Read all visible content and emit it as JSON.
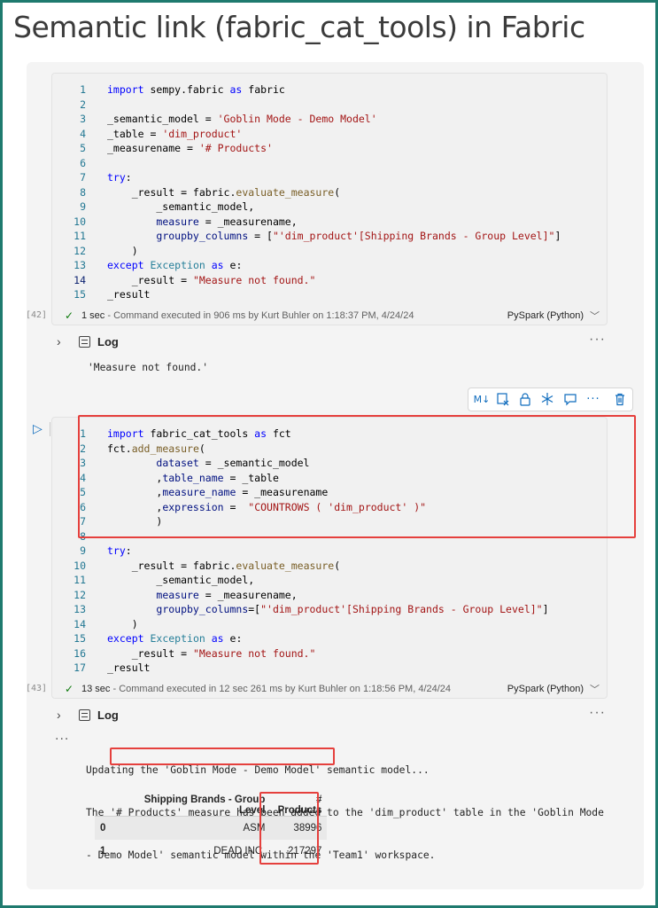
{
  "page_title": "Semantic link (fabric_cat_tools) in Fabric",
  "cell1": {
    "exec_count": "[42]",
    "lines": [
      {
        "n": "1",
        "html": "<span class=\"kw\">import</span> sempy.fabric <span class=\"kw\">as</span> fabric"
      },
      {
        "n": "2",
        "html": ""
      },
      {
        "n": "3",
        "html": "_semantic_model = <span class=\"st\">'Goblin Mode - Demo Model'</span>"
      },
      {
        "n": "4",
        "html": "_table = <span class=\"st\">'dim_product'</span>"
      },
      {
        "n": "5",
        "html": "_measurename = <span class=\"st\">'# Products'</span>"
      },
      {
        "n": "6",
        "html": ""
      },
      {
        "n": "7",
        "html": "<span class=\"kw\">try</span>:"
      },
      {
        "n": "8",
        "html": "    _result = fabric.<span class=\"fn\">evaluate_measure</span>("
      },
      {
        "n": "9",
        "html": "        _semantic_model,"
      },
      {
        "n": "10",
        "html": "        <span class=\"pr\">measure</span> = _measurename,"
      },
      {
        "n": "11",
        "html": "        <span class=\"pr\">groupby_columns</span> = [<span class=\"st\">\"'dim_product'[Shipping Brands - Group Level]\"</span>]"
      },
      {
        "n": "12",
        "html": "    )"
      },
      {
        "n": "13",
        "html": "<span class=\"kw\">except</span> <span class=\"cls\">Exception</span> <span class=\"kw\">as</span> e:"
      },
      {
        "n": "14",
        "html": "    _result = <span class=\"st\">\"Measure not found.\"</span>"
      },
      {
        "n": "15",
        "html": "_result"
      }
    ],
    "status_duration": "1 sec",
    "status_message": "Command executed in 906 ms by Kurt Buhler on 1:18:37 PM, 4/24/24",
    "language": "PySpark (Python)",
    "log_label": "Log",
    "output": "'Measure not found.'"
  },
  "cell2": {
    "exec_count": "[43]",
    "lines": [
      {
        "n": "1",
        "html": "<span class=\"kw\">import</span> fabric_cat_tools <span class=\"kw\">as</span> fct"
      },
      {
        "n": "2",
        "html": "fct.<span class=\"fn\">add_measure</span>("
      },
      {
        "n": "3",
        "html": "        <span class=\"pr\">dataset</span> = _semantic_model"
      },
      {
        "n": "4",
        "html": "        ,<span class=\"pr\">table_name</span> = _table"
      },
      {
        "n": "5",
        "html": "        ,<span class=\"pr\">measure_name</span> = _measurename"
      },
      {
        "n": "6",
        "html": "        ,<span class=\"pr\">expression</span> =  <span class=\"st\">\"COUNTROWS ( 'dim_product' )\"</span>"
      },
      {
        "n": "7",
        "html": "        )"
      },
      {
        "n": "8",
        "html": ""
      },
      {
        "n": "9",
        "html": "<span class=\"kw\">try</span>:"
      },
      {
        "n": "10",
        "html": "    _result = fabric.<span class=\"fn\">evaluate_measure</span>("
      },
      {
        "n": "11",
        "html": "        _semantic_model,"
      },
      {
        "n": "12",
        "html": "        <span class=\"pr\">measure</span> = _measurename,"
      },
      {
        "n": "13",
        "html": "        <span class=\"pr\">groupby_columns</span>=[<span class=\"st\">\"'dim_product'[Shipping Brands - Group Level]\"</span>]"
      },
      {
        "n": "14",
        "html": "    )"
      },
      {
        "n": "15",
        "html": "<span class=\"kw\">except</span> <span class=\"cls\">Exception</span> <span class=\"kw\">as</span> e:"
      },
      {
        "n": "16",
        "html": "    _result = <span class=\"st\">\"Measure not found.\"</span>"
      },
      {
        "n": "17",
        "html": "_result"
      }
    ],
    "status_duration": "13 sec",
    "status_message": "Command executed in 12 sec 261 ms by Kurt Buhler on 1:18:56 PM, 4/24/24",
    "language": "PySpark (Python)",
    "log_label": "Log",
    "output_lines": [
      "Updating the 'Goblin Mode - Demo Model' semantic model...",
      "The '# Products' measure has been added to the 'dim_product' table in the 'Goblin Mode",
      "- Demo Model' semantic model within the 'Team1' workspace."
    ],
    "table": {
      "headers": [
        "",
        "Shipping Brands - Group Level",
        "# Products"
      ],
      "rows": [
        [
          "0",
          "ASM",
          "38996"
        ],
        [
          "1",
          "DEAD INC.",
          "217297"
        ]
      ]
    }
  },
  "toolbar": {
    "markdown_label": "M↓",
    "icons": [
      "markdown-toggle-icon",
      "clear-output-icon",
      "lock-icon",
      "freeze-icon",
      "comment-icon",
      "more-icon",
      "delete-icon"
    ]
  },
  "colors": {
    "frame": "#1f7a6e",
    "highlight": "#e5403d",
    "accent": "#0f6cbd"
  }
}
